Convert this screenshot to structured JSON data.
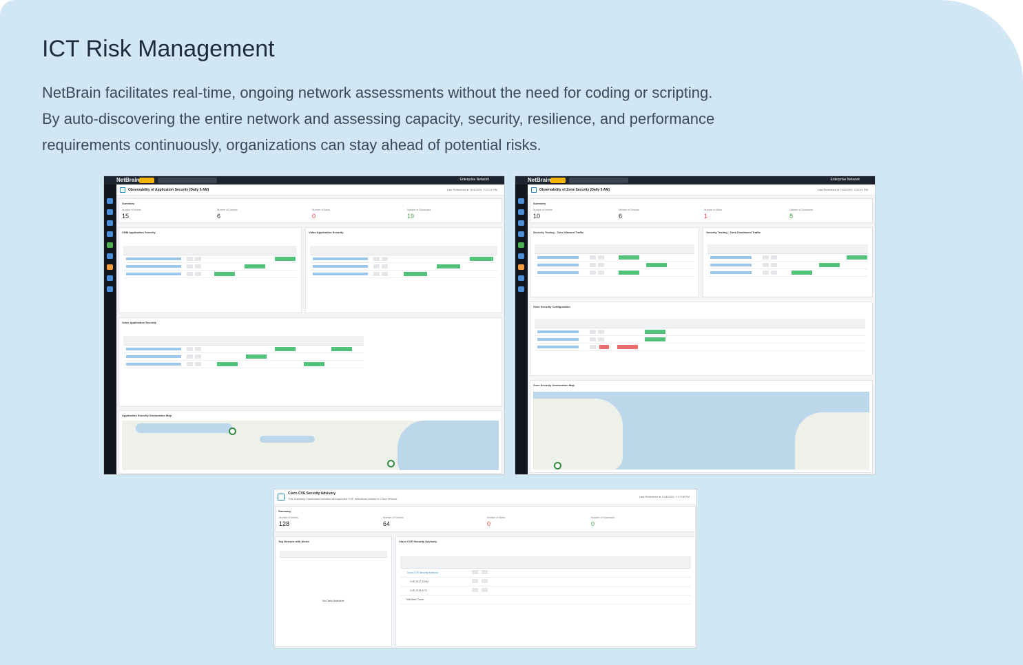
{
  "header": {
    "title": "ICT Risk Management",
    "description_lines": [
      "NetBrain facilitates real-time, ongoing network assessments without the need for coding or scripting.",
      "By auto-discovering the entire network and assessing capacity, security, resilience, and performance",
      "requirements continuously, organizations can stay ahead of potential risks."
    ]
  },
  "screens": {
    "app": {
      "logo": "NetBrain R12",
      "env": "Enterprise Network"
    },
    "s1": {
      "title": "Observability of Application Security (Daily 5 AM)",
      "refreshed": "Last Refreshed at 12/4/2024, 2:27:07 PM",
      "summary": {
        "label": "Summary",
        "metrics": [
          {
            "label": "Number of Intents",
            "value": "15"
          },
          {
            "label": "Number of Devices",
            "value": "6"
          },
          {
            "label": "Number of Alerts",
            "value": "0"
          },
          {
            "label": "Number of Successes",
            "value": "19"
          }
        ]
      },
      "panels": [
        "CRM Application Security",
        "Video Application Security",
        "Voice Application Security",
        "Application Security Geolocation Map"
      ]
    },
    "s2": {
      "title": "Observability of Zone Security (Daily 5 AM)",
      "refreshed": "Last Refreshed at 12/4/2024, 2:20:41 PM",
      "summary": {
        "label": "Summary",
        "metrics": [
          {
            "label": "Number of Intents",
            "value": "10"
          },
          {
            "label": "Number of Devices",
            "value": "6"
          },
          {
            "label": "Number of Alerts",
            "value": "1"
          },
          {
            "label": "Number of Successes",
            "value": "8"
          }
        ]
      },
      "panels": [
        "Security Testing - Zone Allowed Traffic",
        "Security Testing - Zone Disallowed Traffic",
        "Zone Security Configuration",
        "Zone Security Geolocation Map"
      ]
    },
    "s3": {
      "title": "Cisco CVE Security Advisory",
      "subtitle": "This Summary Dashboard includes all supported CVE detections related to Cisco devices",
      "refreshed": "Last Refreshed at 12/4/2024, 2:27:06 PM",
      "summary": {
        "label": "Summary",
        "metrics": [
          {
            "label": "Number of Intents",
            "value": "128"
          },
          {
            "label": "Number of Devices",
            "value": "64"
          },
          {
            "label": "Number of Alerts",
            "value": "0"
          },
          {
            "label": "Number of Successes",
            "value": "0"
          }
        ]
      },
      "panels": [
        "Top Devices with Alerts",
        "Cisco CVE Security Advisory"
      ],
      "no_data": "No Data Available",
      "rows": [
        "Cisco CVE Security Advisory",
        "CVE-2017-12240",
        "CVE-2018-0171"
      ],
      "total": "Total Alert Count"
    }
  }
}
